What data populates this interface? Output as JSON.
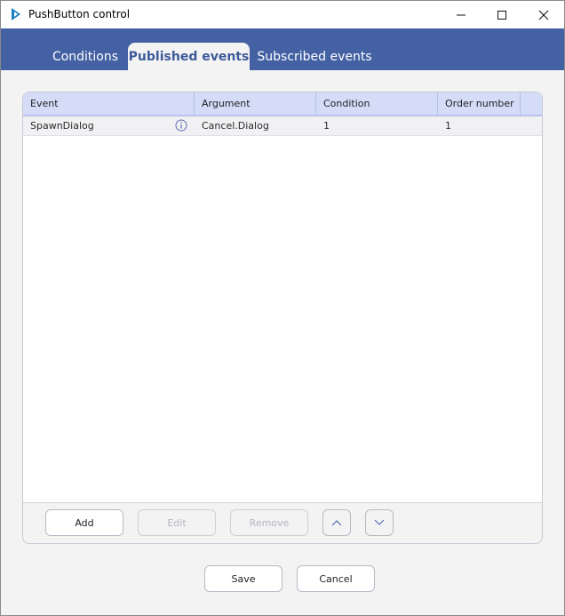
{
  "window": {
    "title": "PushButton control",
    "icons": {
      "app": "app-logo-icon",
      "minimize": "minimize-icon",
      "maximize": "maximize-icon",
      "close": "close-icon"
    }
  },
  "tabs": [
    {
      "label": "Conditions",
      "active": false
    },
    {
      "label": "Published events",
      "active": true
    },
    {
      "label": "Subscribed events",
      "active": false
    }
  ],
  "grid": {
    "columns": [
      "Event",
      "Argument",
      "Condition",
      "Order number"
    ],
    "rows": [
      {
        "event": "SpawnDialog",
        "argument": "Cancel.Dialog",
        "condition": "1",
        "order": "1",
        "icon": "info-icon"
      }
    ]
  },
  "actions": {
    "add": "Add",
    "edit": "Edit",
    "remove": "Remove",
    "move_up_icon": "chevron-up-icon",
    "move_down_icon": "chevron-down-icon"
  },
  "footer": {
    "save": "Save",
    "cancel": "Cancel"
  },
  "colors": {
    "tab_band": "#4361a3",
    "active_tab_text": "#3c5a9a",
    "grid_header": "#d4dcf8",
    "disabled_text": "#b5b5c0"
  }
}
